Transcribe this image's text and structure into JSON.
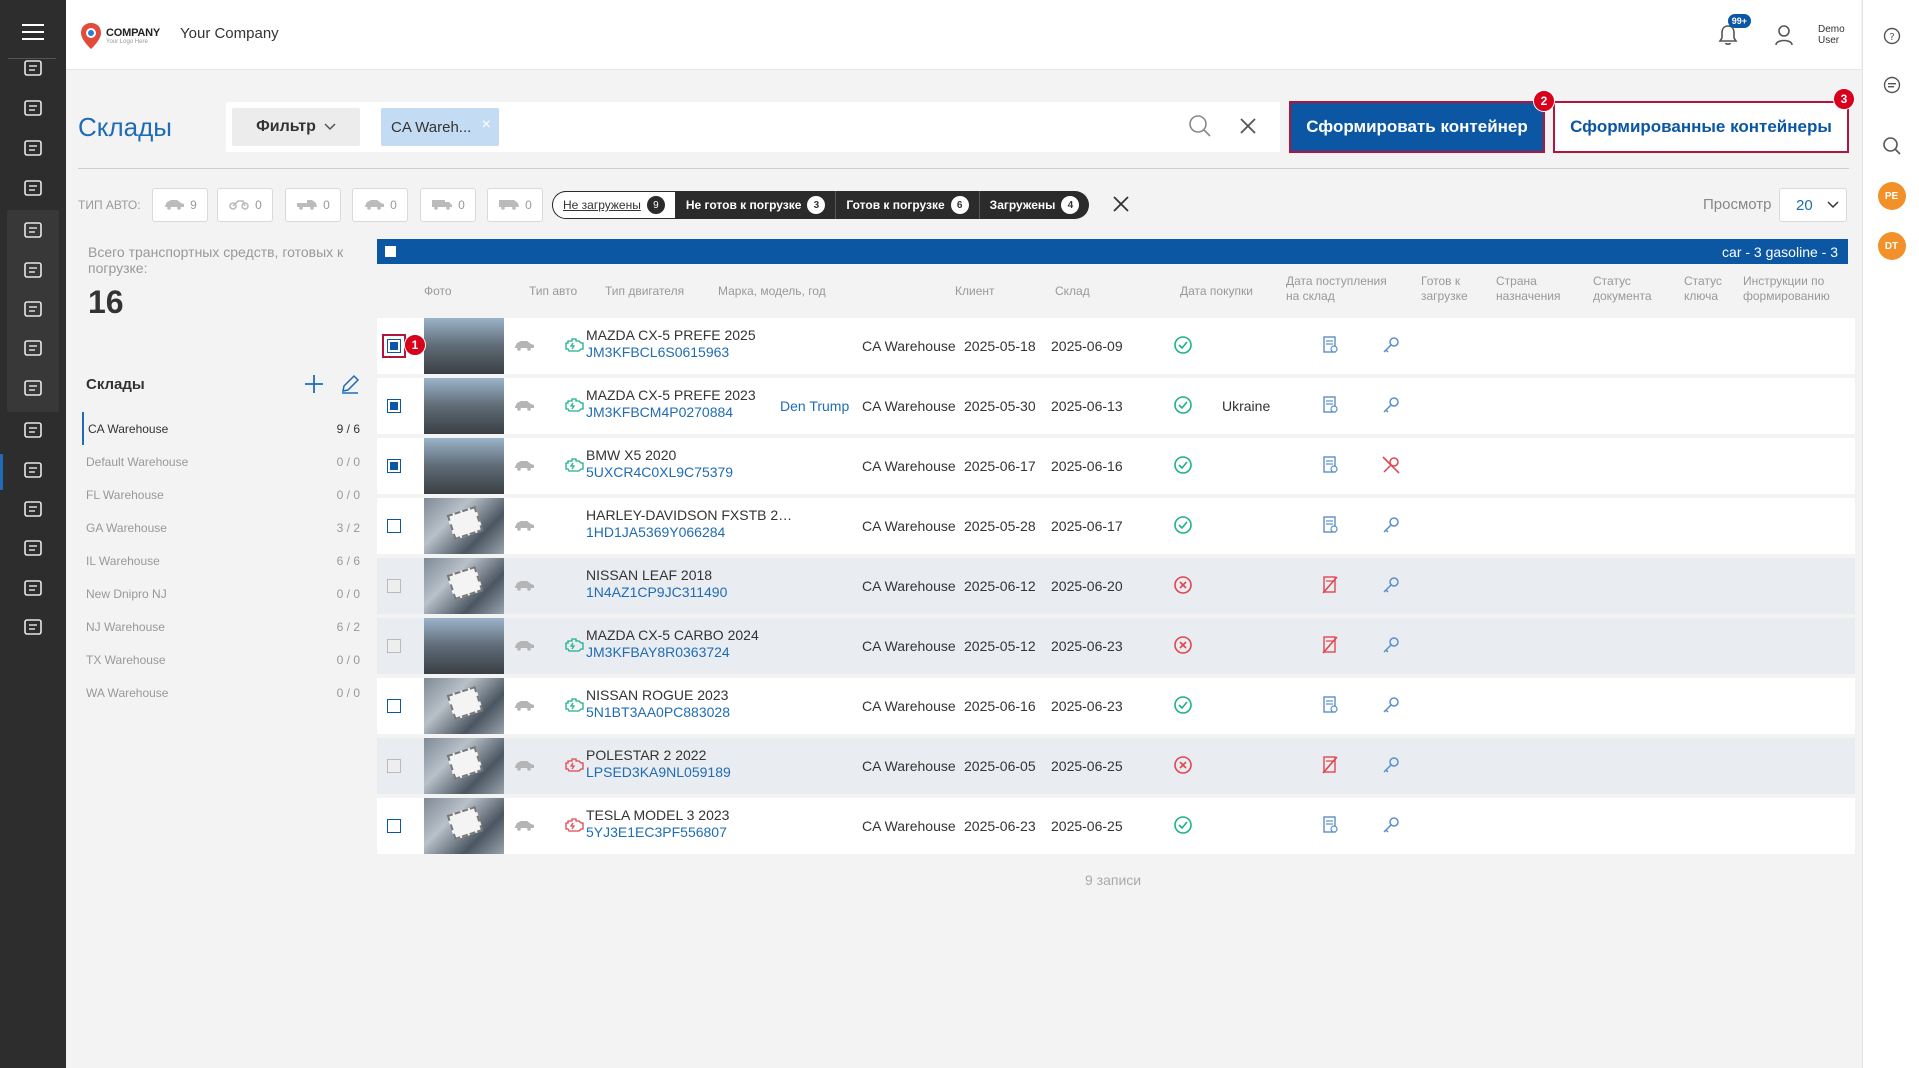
{
  "header": {
    "logo_text": "COMPANY",
    "logo_subtext": "Your Logo Here",
    "company_name": "Your Company",
    "notifications_badge": "99+",
    "user_name": "Demo User"
  },
  "page": {
    "title": "Склады",
    "filter_label": "Фильтр",
    "filter_chip": "CA Wareh...",
    "btn_form_container": "Сформировать контейнер",
    "btn_formed_containers": "Сформированные контейнеры",
    "markers": [
      "1",
      "2",
      "3"
    ]
  },
  "vehicle_types": {
    "label": "ТИП АВТО:",
    "items": [
      {
        "icon": "sedan-icon",
        "count": "9"
      },
      {
        "icon": "motorcycle-icon",
        "count": "0"
      },
      {
        "icon": "pickup-icon",
        "count": "0"
      },
      {
        "icon": "suv-icon",
        "count": "0"
      },
      {
        "icon": "truck-icon",
        "count": "0"
      },
      {
        "icon": "van-icon",
        "count": "0"
      }
    ]
  },
  "status_filters": [
    {
      "label": "Не загружены",
      "count": "9"
    },
    {
      "label": "Не готов к погрузке",
      "count": "3"
    },
    {
      "label": "Готов к погрузке",
      "count": "6"
    },
    {
      "label": "Загружены",
      "count": "4"
    }
  ],
  "view": {
    "label": "Просмотр",
    "value": "20"
  },
  "left_panel": {
    "total_label": "Всего транспортных средств, готовых к погрузке:",
    "total_value": "16",
    "warehouses_title": "Склады",
    "warehouses": [
      {
        "name": "CA Warehouse",
        "count": "9 / 6",
        "active": true
      },
      {
        "name": "Default Warehouse",
        "count": "0 / 0"
      },
      {
        "name": "FL Warehouse",
        "count": "0 / 0"
      },
      {
        "name": "GA Warehouse",
        "count": "3 / 2"
      },
      {
        "name": "IL Warehouse",
        "count": "6 / 6"
      },
      {
        "name": "New Dnipro NJ",
        "count": "0 / 0"
      },
      {
        "name": "NJ Warehouse",
        "count": "6 / 2"
      },
      {
        "name": "TX Warehouse",
        "count": "0 / 0"
      },
      {
        "name": "WA Warehouse",
        "count": "0 / 0"
      }
    ]
  },
  "table": {
    "summary": "car - 3 gasoline - 3",
    "columns": {
      "photo": "Фото",
      "vtype": "Тип авто",
      "engine": "Тип двигателя",
      "model": "Марка, модель, год",
      "client": "Клиент",
      "warehouse": "Склад",
      "purchase": "Дата покупки",
      "arrival": "Дата поступления на склад",
      "ready": "Готов к загрузке",
      "country": "Страна назначения",
      "doc": "Статус документа",
      "key": "Статус ключа",
      "instructions": "Инструкции по формированию"
    },
    "rows": [
      {
        "checkbox": "checked",
        "photo": "car",
        "engine": "gasoline",
        "model": "MAZDA CX-5 PREFE 2025",
        "vin": "JM3KFBCL6S0615963",
        "client": "",
        "warehouse": "CA Warehouse",
        "purchase": "2025-05-18",
        "arrival": "2025-06-09",
        "ready": true,
        "country": "",
        "doc": "ok",
        "key": "ok",
        "grey": false
      },
      {
        "checkbox": "checked",
        "photo": "car",
        "engine": "gasoline",
        "model": "MAZDA CX-5 PREFE 2023",
        "vin": "JM3KFBCM4P0270884",
        "client": "Den Trump",
        "warehouse": "CA Warehouse",
        "purchase": "2025-05-30",
        "arrival": "2025-06-13",
        "ready": true,
        "country": "Ukraine",
        "doc": "ok",
        "key": "ok",
        "grey": false
      },
      {
        "checkbox": "checked",
        "photo": "car",
        "engine": "gasoline",
        "model": "BMW X5 2020",
        "vin": "5UXCR4C0XL9C75379",
        "client": "",
        "warehouse": "CA Warehouse",
        "purchase": "2025-06-17",
        "arrival": "2025-06-16",
        "ready": true,
        "country": "",
        "doc": "ok",
        "key": "missing",
        "grey": false
      },
      {
        "checkbox": "empty",
        "photo": "sticker",
        "engine": "",
        "model": "HARLEY-DAVIDSON FXSTB 20...",
        "vin": "1HD1JA5369Y066284",
        "client": "",
        "warehouse": "CA Warehouse",
        "purchase": "2025-05-28",
        "arrival": "2025-06-17",
        "ready": true,
        "country": "",
        "doc": "ok",
        "key": "ok",
        "grey": false
      },
      {
        "checkbox": "disabled",
        "photo": "sticker",
        "engine": "",
        "model": "NISSAN LEAF 2018",
        "vin": "1N4AZ1CP9JC311490",
        "client": "",
        "warehouse": "CA Warehouse",
        "purchase": "2025-06-12",
        "arrival": "2025-06-20",
        "ready": false,
        "country": "",
        "doc": "missing",
        "key": "ok",
        "grey": true
      },
      {
        "checkbox": "disabled",
        "photo": "car",
        "engine": "gasoline",
        "model": "MAZDA CX-5 CARBO 2024",
        "vin": "JM3KFBAY8R0363724",
        "client": "",
        "warehouse": "CA Warehouse",
        "purchase": "2025-05-12",
        "arrival": "2025-06-23",
        "ready": false,
        "country": "",
        "doc": "missing",
        "key": "ok",
        "grey": true
      },
      {
        "checkbox": "empty",
        "photo": "sticker",
        "engine": "gasoline",
        "model": "NISSAN ROGUE 2023",
        "vin": "5N1BT3AA0PC883028",
        "client": "",
        "warehouse": "CA Warehouse",
        "purchase": "2025-06-16",
        "arrival": "2025-06-23",
        "ready": true,
        "country": "",
        "doc": "ok",
        "key": "ok",
        "grey": false
      },
      {
        "checkbox": "disabled",
        "photo": "sticker",
        "engine": "electric",
        "model": "POLESTAR 2 2022",
        "vin": "LPSED3KA9NL059189",
        "client": "",
        "warehouse": "CA Warehouse",
        "purchase": "2025-06-05",
        "arrival": "2025-06-25",
        "ready": false,
        "country": "",
        "doc": "missing",
        "key": "ok",
        "grey": true
      },
      {
        "checkbox": "empty",
        "photo": "sticker",
        "engine": "electric",
        "model": "TESLA MODEL 3 2023",
        "vin": "5YJ3E1EC3PF556807",
        "client": "",
        "warehouse": "CA Warehouse",
        "purchase": "2025-06-23",
        "arrival": "2025-06-25",
        "ready": true,
        "country": "",
        "doc": "ok",
        "key": "ok",
        "grey": false
      }
    ],
    "footer": "9 записи"
  },
  "colors": {
    "primary": "#0b57a4",
    "accent_red": "#b2143c",
    "ok_green": "#1db08a",
    "error_red": "#e0464f",
    "sidebar": "#2d2d2d"
  },
  "sidebar_icons": [
    "dashboard-icon",
    "tasks-icon",
    "client-search-icon",
    "building-icon",
    "finance-icon",
    "documents-icon",
    "user-add-icon",
    "users-icon",
    "settings-user-icon",
    "invoice-icon",
    "warehouse-icon",
    "loading-icon",
    "port-icon",
    "calculator-icon",
    "gear-icon"
  ],
  "rail": {
    "avatars": [
      "PE",
      "DT"
    ]
  }
}
